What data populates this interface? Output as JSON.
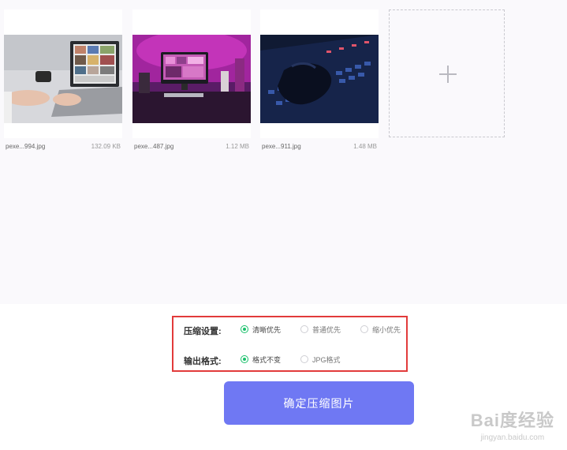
{
  "files": [
    {
      "name": "pexe...994.jpg",
      "size": "132.09 KB",
      "image": "laptop-photo-gallery"
    },
    {
      "name": "pexe...487.jpg",
      "size": "1.12 MB",
      "image": "pink-lit-desk-monitor"
    },
    {
      "name": "pexe...911.jpg",
      "size": "1.48 MB",
      "image": "hands-on-backlit-keyboard"
    }
  ],
  "add_card": {
    "icon": "plus-icon"
  },
  "compression": {
    "label": "压缩设置:",
    "options": [
      "清晰优先",
      "普通优先",
      "缩小优先"
    ],
    "selected": "清晰优先"
  },
  "output_format": {
    "label": "输出格式:",
    "options": [
      "格式不变",
      "JPG格式"
    ],
    "selected": "格式不变"
  },
  "confirm_button": {
    "label": "确定压缩图片"
  },
  "watermark": {
    "logo": "Bai度经验",
    "url": "jingyan.baidu.com"
  },
  "colors": {
    "accent": "#6f78f3",
    "radio_selected": "#18c06a",
    "highlight_border": "#e23b3b",
    "upload_bg": "#faf9fc"
  }
}
